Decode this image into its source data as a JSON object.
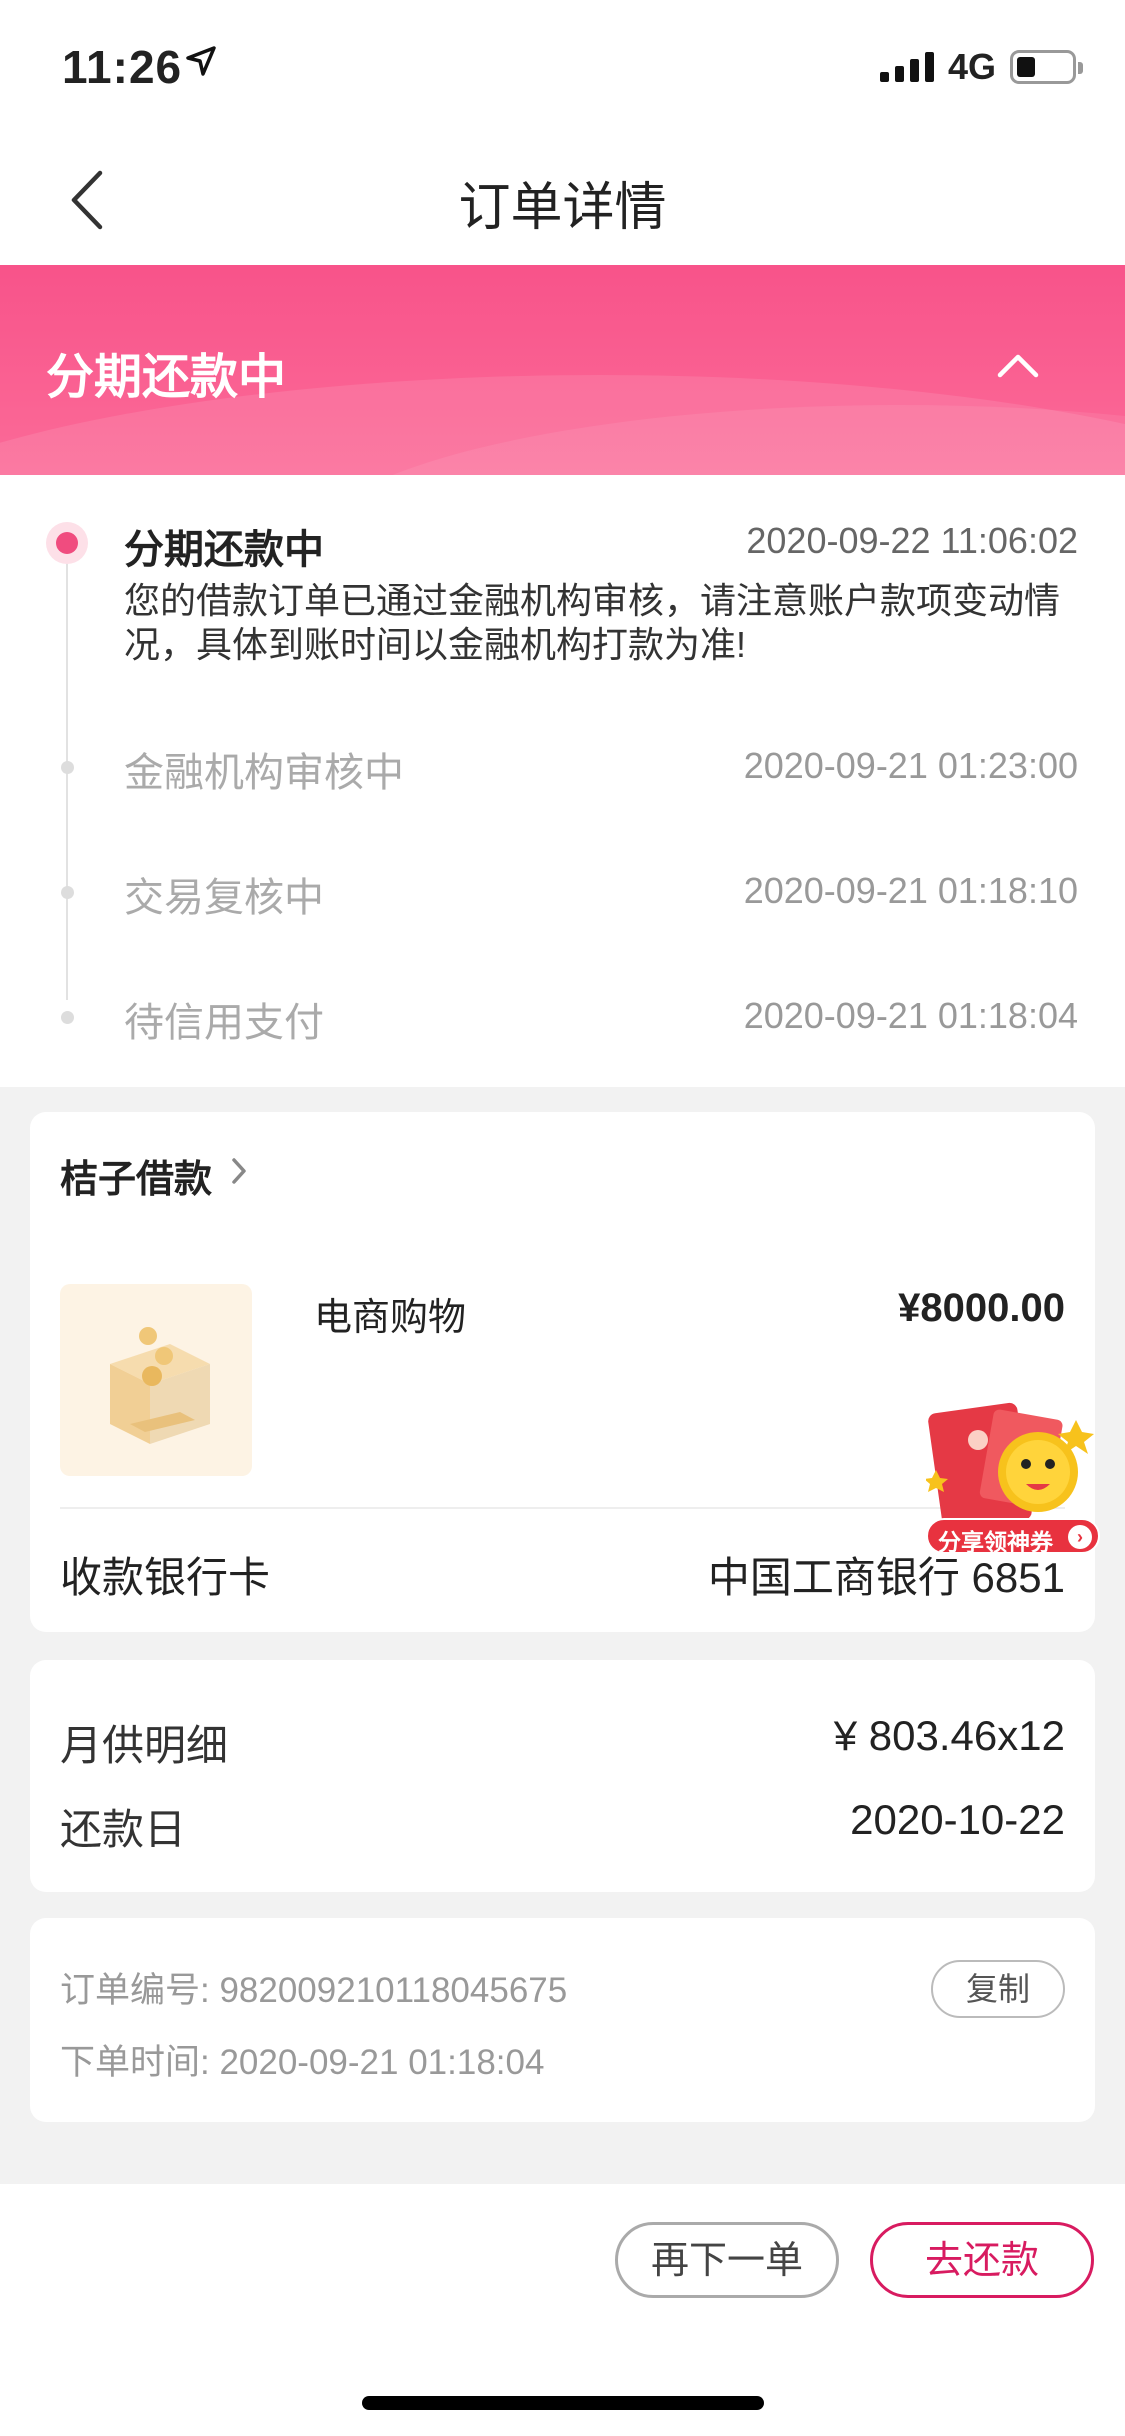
{
  "status_bar": {
    "time": "11:26",
    "network": "4G"
  },
  "nav": {
    "title": "订单详情"
  },
  "banner": {
    "title": "分期还款中"
  },
  "timeline": [
    {
      "title": "分期还款中",
      "time": "2020-09-22 11:06:02",
      "desc": "您的借款订单已通过金融机构审核，请注意账户款项变动情况，具体到账时间以金融机构打款为准!",
      "active": true
    },
    {
      "title": "金融机构审核中",
      "time": "2020-09-21 01:23:00"
    },
    {
      "title": "交易复核中",
      "time": "2020-09-21 01:18:10"
    },
    {
      "title": "待信用支付",
      "time": "2020-09-21 01:18:04"
    }
  ],
  "order": {
    "lender": "桔子借款",
    "product_name": "电商购物",
    "price": "¥8000.00",
    "bank_label": "收款银行卡",
    "bank_value": "中国工商银行 6851",
    "promo_label": "分享领神券"
  },
  "repayment": {
    "monthly_label": "月供明细",
    "monthly_value": "¥ 803.46x12",
    "due_label": "还款日",
    "due_value": "2020-10-22"
  },
  "meta": {
    "order_no": "订单编号: 982009210118045675",
    "order_time": "下单时间: 2020-09-21 01:18:04",
    "copy_label": "复制"
  },
  "footer": {
    "reorder_label": "再下一单",
    "repay_label": "去还款"
  },
  "colors": {
    "accent": "#f04c7f",
    "banner": "#f8538a",
    "repay": "#d81b60"
  }
}
